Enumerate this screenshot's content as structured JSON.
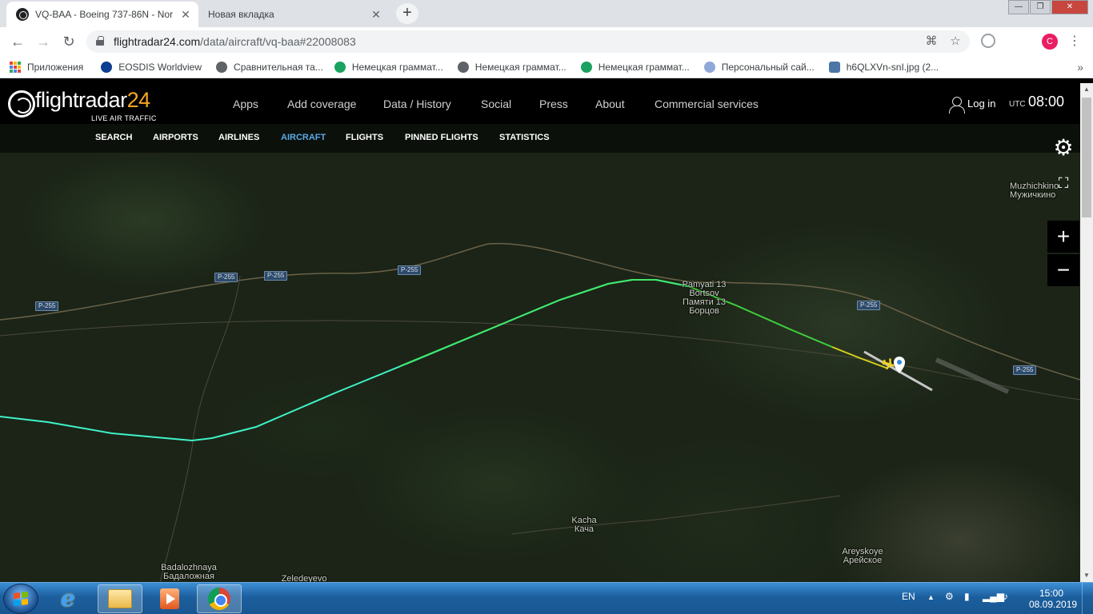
{
  "browser": {
    "tabs": [
      {
        "title": "VQ-BAA - Boeing 737-86N - Nor",
        "close": "✕"
      },
      {
        "title": "Новая вкладка",
        "close": "✕"
      }
    ],
    "new_tab": "+",
    "window_buttons": {
      "minimize": "—",
      "maximize": "❐",
      "close": "✕"
    },
    "nav": {
      "back": "←",
      "forward": "→",
      "reload": "↻"
    },
    "url_host": "flightradar24.com",
    "url_path": "/data/aircraft/vq-baa#22008083",
    "profile_initial": "C",
    "bookmarks": [
      {
        "label": "Приложения",
        "icon": "apps-grid-icon"
      },
      {
        "label": "EOSDIS Worldview",
        "icon": "nasa-icon"
      },
      {
        "label": "Сравнительная та...",
        "icon": "globe-icon"
      },
      {
        "label": "Немецкая граммат...",
        "icon": "green-a-icon"
      },
      {
        "label": "Немецкая граммат...",
        "icon": "globe-icon"
      },
      {
        "label": "Немецкая граммат...",
        "icon": "green-a-icon"
      },
      {
        "label": "Персональный сай...",
        "icon": "shield-icon"
      },
      {
        "label": "h6QLXVn-snI.jpg (2...",
        "icon": "vk-icon"
      }
    ],
    "bookmarks_more": "»"
  },
  "site": {
    "logo_word": "flightradar",
    "logo_num": "24",
    "logo_sub": "LIVE AIR TRAFFIC",
    "nav": [
      "Apps",
      "Add coverage",
      "Data / History",
      "Social",
      "Press",
      "About",
      "Commercial services"
    ],
    "login": "Log in",
    "utc_label": "UTC",
    "time": "08:00",
    "subnav": [
      "SEARCH",
      "AIRPORTS",
      "AIRLINES",
      "AIRCRAFT",
      "FLIGHTS",
      "PINNED FLIGHTS",
      "STATISTICS"
    ],
    "subnav_active": "AIRCRAFT"
  },
  "map": {
    "places": [
      {
        "latin": "Pamyati 13 Bortsov",
        "cyr": "Памяти 13 Борцов"
      },
      {
        "latin": "Kacha",
        "cyr": "Кача"
      },
      {
        "latin": "Areyskoye",
        "cyr": "Арейское"
      },
      {
        "latin": "Badalozhnaya",
        "cyr": "Бадаложная"
      },
      {
        "latin": "Muzhichkino",
        "cyr": "Мужичкино"
      },
      {
        "latin": "Zeledeyevo",
        "cyr": ""
      }
    ],
    "road_label": "P-255",
    "controls": {
      "settings": "⚙",
      "fullscreen": "⛶",
      "zoom_in": "+",
      "zoom_out": "−"
    },
    "track_colors": [
      "#3ff2c8",
      "#41e86a",
      "#3fd23c",
      "#d8d21c"
    ]
  },
  "taskbar": {
    "lang": "EN",
    "time": "15:00",
    "date": "08.09.2019"
  }
}
